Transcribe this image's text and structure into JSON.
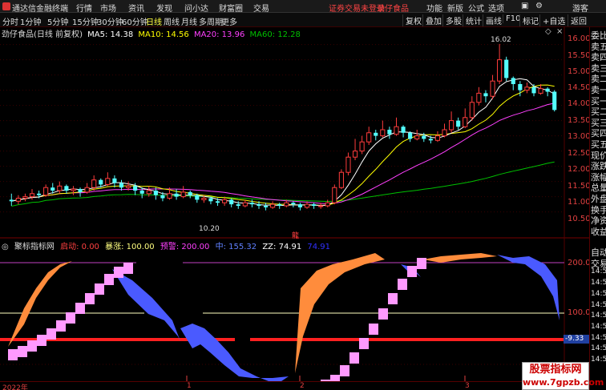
{
  "app": {
    "title": "通达信金融终端",
    "menu": [
      "行情",
      "市场",
      "资讯",
      "发现",
      "问小达",
      "财富圈",
      "交易"
    ],
    "login_warning": "证券交易未登录",
    "stock_link": "劲仔食品",
    "right_menu": [
      "功能",
      "新版",
      "公式",
      "选项"
    ],
    "guest": "游客"
  },
  "period_tabs": [
    "分时",
    "1分钟",
    "5分钟",
    "15分钟",
    "30分钟",
    "60分钟",
    "日线",
    "周线",
    "月线",
    "多周期",
    "更多"
  ],
  "active_period": "日线",
  "toolbar": [
    "复权",
    "叠加",
    "多股",
    "统计",
    "画线",
    "F10",
    "标记",
    "+自选",
    "返回"
  ],
  "chart_info": {
    "name": "劲仔食品(日线 前复权)",
    "ma5": "MA5: 14.38",
    "ma10": "MA10: 14.56",
    "ma20": "MA20: 13.96",
    "ma60": "MA60: 12.28"
  },
  "price_axis": [
    "16.00",
    "15.50",
    "15.00",
    "14.50",
    "14.00",
    "13.50",
    "13.00",
    "12.50",
    "12.00",
    "11.50",
    "11.00",
    "10.50"
  ],
  "annotations": {
    "high": "16.02",
    "low": "10.20",
    "marker": "龍"
  },
  "indicator_info": {
    "name": "聚标指标网",
    "start": "启动: 0.00",
    "sell": "暴涨: 100.00",
    "over": "预警: 200.00",
    "mid": "中: 155.32",
    "zz": "ZZ: 74.91",
    "extra": "74.91"
  },
  "indicator_axis": [
    "200.0",
    "100.0"
  ],
  "indicator_current": "-9.33",
  "right_panel": [
    "委比",
    "卖五",
    "卖四",
    "卖三",
    "卖二",
    "卖一",
    "买一",
    "买二",
    "买三",
    "买四",
    "买五",
    "现价",
    "涨跌",
    "涨幅",
    "总量",
    "外盘",
    "换手",
    "净资",
    "收益"
  ],
  "right_panel_lower": [
    "自动",
    "交易",
    "14:50",
    "14:50",
    "14:50",
    "14:50",
    "14:50",
    "14:50",
    "14:50",
    "14:50",
    "14:50"
  ],
  "time_axis": [
    "2022年",
    "1",
    "2",
    "3"
  ],
  "watermark": {
    "line1": "股票指标网",
    "line2": "www.7gpzb.com"
  },
  "colors": {
    "up": "#ff3c3c",
    "down": "#54ffff",
    "ma5": "#ffffff",
    "ma10": "#ffff00",
    "ma20": "#ff40ff",
    "ma60": "#00c000",
    "orange": "#ff8c3c",
    "pink": "#ff99ff",
    "blue": "#4a5aff"
  },
  "chart_data": {
    "type": "candlestick",
    "ylim": [
      10.2,
      16.2
    ],
    "candles": [
      [
        10.9,
        10.85,
        11.1,
        10.7
      ],
      [
        10.85,
        10.95,
        11.05,
        10.75
      ],
      [
        10.95,
        11.0,
        11.1,
        10.85
      ],
      [
        11.0,
        11.1,
        11.25,
        10.9
      ],
      [
        11.1,
        11.05,
        11.2,
        10.95
      ],
      [
        11.05,
        11.3,
        11.4,
        11.0
      ],
      [
        11.3,
        11.2,
        11.45,
        11.1
      ],
      [
        11.2,
        11.35,
        11.5,
        11.1
      ],
      [
        11.35,
        11.2,
        11.4,
        11.1
      ],
      [
        11.2,
        11.25,
        11.35,
        11.05
      ],
      [
        11.25,
        11.15,
        11.3,
        11.0
      ],
      [
        11.15,
        11.3,
        11.45,
        11.1
      ],
      [
        11.3,
        11.55,
        11.7,
        11.2
      ],
      [
        11.55,
        11.4,
        11.6,
        11.3
      ],
      [
        11.4,
        11.6,
        11.8,
        11.35
      ],
      [
        11.6,
        11.45,
        11.7,
        11.3
      ],
      [
        11.45,
        11.3,
        11.55,
        11.2
      ],
      [
        11.3,
        11.35,
        11.5,
        11.2
      ],
      [
        11.35,
        11.2,
        11.45,
        11.05
      ],
      [
        11.2,
        11.1,
        11.3,
        10.95
      ],
      [
        11.1,
        11.2,
        11.35,
        11.0
      ],
      [
        11.2,
        11.05,
        11.3,
        10.9
      ],
      [
        11.05,
        10.95,
        11.15,
        10.85
      ],
      [
        10.95,
        11.1,
        11.3,
        10.9
      ],
      [
        11.1,
        11.0,
        11.25,
        10.9
      ],
      [
        11.0,
        11.15,
        11.35,
        10.95
      ],
      [
        11.15,
        11.05,
        11.2,
        10.95
      ],
      [
        11.05,
        10.9,
        11.1,
        10.8
      ],
      [
        10.9,
        10.95,
        11.05,
        10.8
      ],
      [
        10.95,
        10.85,
        11.0,
        10.75
      ],
      [
        10.85,
        10.8,
        10.95,
        10.7
      ],
      [
        10.8,
        10.9,
        11.0,
        10.7
      ],
      [
        10.9,
        10.75,
        10.95,
        10.65
      ],
      [
        10.75,
        10.7,
        10.85,
        10.6
      ],
      [
        10.7,
        10.8,
        10.9,
        10.65
      ],
      [
        10.8,
        10.75,
        10.9,
        10.65
      ],
      [
        10.75,
        10.7,
        10.85,
        10.6
      ],
      [
        10.7,
        10.65,
        10.8,
        10.55
      ],
      [
        10.65,
        10.75,
        10.85,
        10.6
      ],
      [
        10.75,
        10.7,
        10.8,
        10.6
      ],
      [
        10.7,
        10.8,
        10.9,
        10.65
      ],
      [
        10.8,
        10.75,
        10.85,
        10.65
      ],
      [
        10.75,
        10.65,
        10.8,
        10.55
      ],
      [
        10.65,
        10.75,
        10.85,
        10.6
      ],
      [
        10.75,
        10.7,
        10.8,
        10.6
      ],
      [
        10.7,
        10.7,
        10.8,
        10.6
      ],
      [
        10.7,
        10.8,
        10.9,
        10.65
      ],
      [
        10.8,
        11.3,
        11.4,
        10.75
      ],
      [
        11.3,
        11.8,
        11.9,
        11.25
      ],
      [
        11.8,
        12.3,
        12.45,
        11.7
      ],
      [
        12.3,
        12.5,
        12.9,
        12.2
      ],
      [
        12.5,
        12.8,
        13.0,
        12.4
      ],
      [
        12.8,
        13.1,
        13.3,
        12.7
      ],
      [
        13.1,
        13.0,
        13.2,
        12.85
      ],
      [
        13.0,
        13.2,
        13.5,
        12.95
      ],
      [
        13.2,
        13.05,
        13.3,
        12.9
      ],
      [
        13.05,
        13.3,
        13.6,
        13.0
      ],
      [
        13.3,
        13.1,
        13.35,
        12.95
      ],
      [
        13.1,
        12.9,
        13.15,
        12.8
      ],
      [
        12.9,
        13.0,
        13.2,
        12.85
      ],
      [
        13.0,
        12.9,
        13.1,
        12.8
      ],
      [
        12.9,
        12.85,
        13.0,
        12.75
      ],
      [
        12.85,
        13.0,
        13.15,
        12.8
      ],
      [
        13.0,
        13.2,
        13.4,
        12.95
      ],
      [
        13.2,
        13.5,
        13.8,
        13.1
      ],
      [
        13.5,
        13.3,
        13.6,
        13.2
      ],
      [
        13.3,
        13.6,
        13.9,
        13.25
      ],
      [
        13.6,
        14.1,
        14.3,
        13.5
      ],
      [
        14.1,
        14.4,
        14.6,
        14.0
      ],
      [
        14.4,
        14.3,
        14.5,
        14.1
      ],
      [
        14.3,
        14.8,
        15.0,
        14.2
      ],
      [
        14.8,
        15.5,
        16.02,
        14.7
      ],
      [
        15.5,
        14.9,
        15.6,
        14.8
      ],
      [
        14.9,
        14.7,
        14.95,
        14.5
      ],
      [
        14.7,
        14.5,
        14.8,
        14.3
      ],
      [
        14.5,
        14.6,
        14.75,
        14.4
      ],
      [
        14.6,
        14.4,
        14.7,
        14.3
      ],
      [
        14.4,
        14.55,
        14.7,
        14.35
      ],
      [
        14.55,
        14.45,
        14.6,
        14.3
      ],
      [
        14.45,
        13.85,
        14.5,
        13.8
      ]
    ]
  }
}
